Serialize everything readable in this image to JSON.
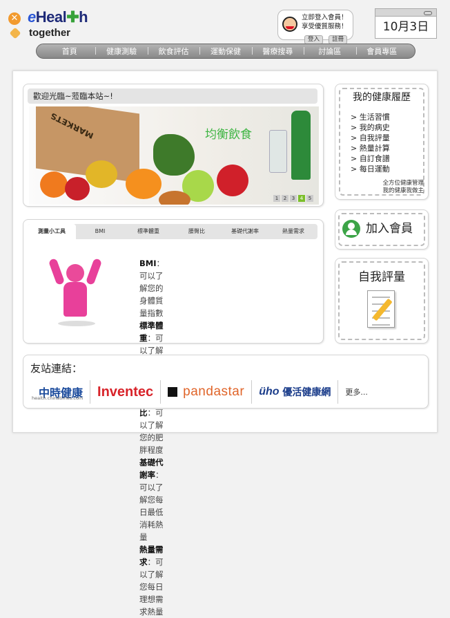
{
  "logo": {
    "brand_e": "e",
    "brand_a": "Heal",
    "brand_plus": "✚",
    "brand_b": "h",
    "tagline": "together"
  },
  "member": {
    "line1": "立即登入會員！",
    "line2": "享受優質服務！",
    "login": "登入",
    "register": "註冊"
  },
  "calendar": {
    "date": "10月3日"
  },
  "nav": {
    "items": [
      "首頁",
      "健康測驗",
      "飲食評估",
      "運動保健",
      "醫療搜尋",
      "討論區",
      "會員專區"
    ]
  },
  "welcome": {
    "title": "歡迎光臨~蒞臨本站~!",
    "bag_label": "MARKETS",
    "slogan": "均衡飲食",
    "pager": [
      "1",
      "2",
      "3",
      "4",
      "5"
    ]
  },
  "tools": {
    "tabs": [
      "測量小工具",
      "BMI",
      "標準體重",
      "腰臀比",
      "基礎代謝率",
      "熱量需求"
    ],
    "defs": [
      {
        "term": "BMI",
        "desc": "：可以了解您的身體質量指數"
      },
      {
        "term": "標準體重",
        "desc": "：可以了解您最理想的體重數"
      },
      {
        "term": "腰臀比",
        "desc": "：可以了解您的肥胖程度"
      },
      {
        "term": "基礎代謝率",
        "desc": "：可以了解您每日最低消耗熱量"
      },
      {
        "term": "熱量需求",
        "desc": "：可以了解您每日理想需求熱量"
      }
    ]
  },
  "history": {
    "title": "我的健康履歷",
    "items": [
      "生活習慣",
      "我的病史",
      "自我評量",
      "熱量計算",
      "自訂食譜",
      "每日運動"
    ],
    "foot1": "全方位健康管理",
    "foot2": "我的健康我做主"
  },
  "join": {
    "label": "加入會員"
  },
  "assess": {
    "label": "自我評量"
  },
  "links": {
    "title": "友站連結：",
    "china": "中時健康",
    "china_url": "health.chinatimes.com",
    "inventec": "Inventec",
    "panda": "pandastar",
    "uho_a": "üho",
    "uho_b": "優活健康網",
    "more": "更多..."
  },
  "colors": {
    "accent_green": "#3fb544",
    "nav_gray": "#9a9a9a",
    "pink": "#e8409a"
  }
}
